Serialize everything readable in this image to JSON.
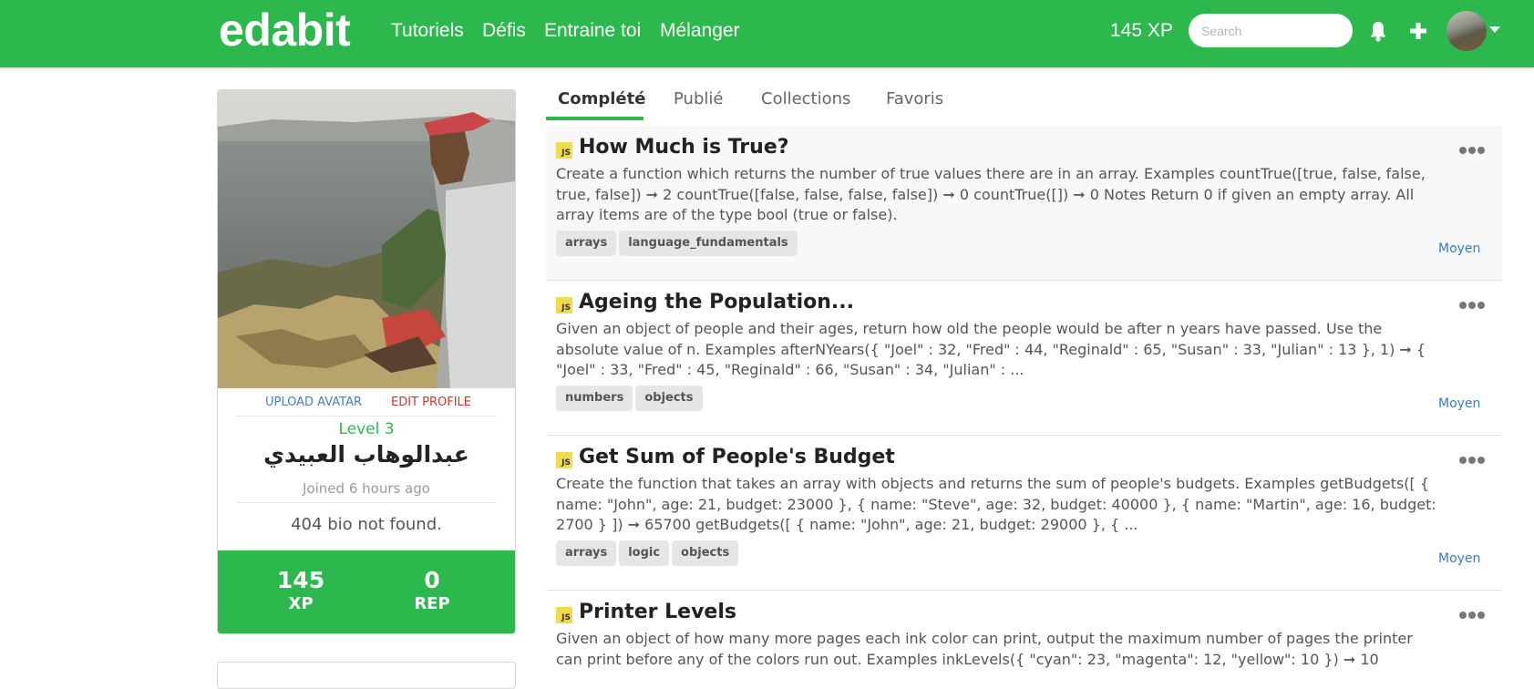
{
  "header": {
    "logo": "edabit",
    "nav": [
      "Tutoriels",
      "Défis",
      "Entraine toi",
      "Mélanger"
    ],
    "xp": "145 XP",
    "search_placeholder": "Search",
    "icons": [
      "bell-icon",
      "plus-icon",
      "avatar",
      "caret-down-icon"
    ],
    "brand_color": "#2db84d"
  },
  "profile": {
    "upload_avatar": "UPLOAD AVATAR",
    "edit_profile": "EDIT PROFILE",
    "level": "Level 3",
    "name": "عبدالوهاب العبيدي",
    "joined": "Joined 6 hours ago",
    "bio": "404 bio not found.",
    "stats": [
      {
        "value": "145",
        "label": "XP"
      },
      {
        "value": "0",
        "label": "REP"
      }
    ]
  },
  "tabs": [
    {
      "label": "Complété",
      "active": true
    },
    {
      "label": "Publié",
      "active": false
    },
    {
      "label": "Collections",
      "active": false
    },
    {
      "label": "Favoris",
      "active": false
    }
  ],
  "challenges": [
    {
      "title": "How Much is True?",
      "description": "Create a function which returns the number of true values there are in an array. Examples countTrue([true, false, false, true, false]) ➞ 2 countTrue([false, false, false, false]) ➞ 0 countTrue([]) ➞ 0 Notes Return 0 if given an empty array. All array items are of the type bool (true or false).",
      "tags": [
        "arrays",
        "language_fundamentals"
      ],
      "difficulty": "Moyen",
      "language_badge": "JS"
    },
    {
      "title": "Ageing the Population...",
      "description": "Given an object of people and their ages, return how old the people would be after n years have passed. Use the absolute value of n. Examples afterNYears({ \"Joel\" : 32, \"Fred\" : 44, \"Reginald\" : 65, \"Susan\" : 33, \"Julian\" : 13 }, 1) ➞ { \"Joel\" : 33, \"Fred\" : 45, \"Reginald\" : 66, \"Susan\" : 34, \"Julian\" : ...",
      "tags": [
        "numbers",
        "objects"
      ],
      "difficulty": "Moyen",
      "language_badge": "JS"
    },
    {
      "title": "Get Sum of People's Budget",
      "description": "Create the function that takes an array with objects and returns the sum of people's budgets. Examples getBudgets([ { name: \"John\", age: 21, budget: 23000 }, { name: \"Steve\", age: 32, budget: 40000 }, { name: \"Martin\", age: 16, budget: 2700 } ]) ➞ 65700 getBudgets([ { name: \"John\", age: 21, budget: 29000 }, { ...",
      "tags": [
        "arrays",
        "logic",
        "objects"
      ],
      "difficulty": "Moyen",
      "language_badge": "JS"
    },
    {
      "title": "Printer Levels",
      "description": "Given an object of how many more pages each ink color can print, output the maximum number of pages the printer can print before any of the colors run out. Examples inkLevels({ \"cyan\": 23, \"magenta\": 12, \"yellow\": 10 }) ➞ 10",
      "tags": [],
      "difficulty": "",
      "language_badge": "JS"
    }
  ]
}
